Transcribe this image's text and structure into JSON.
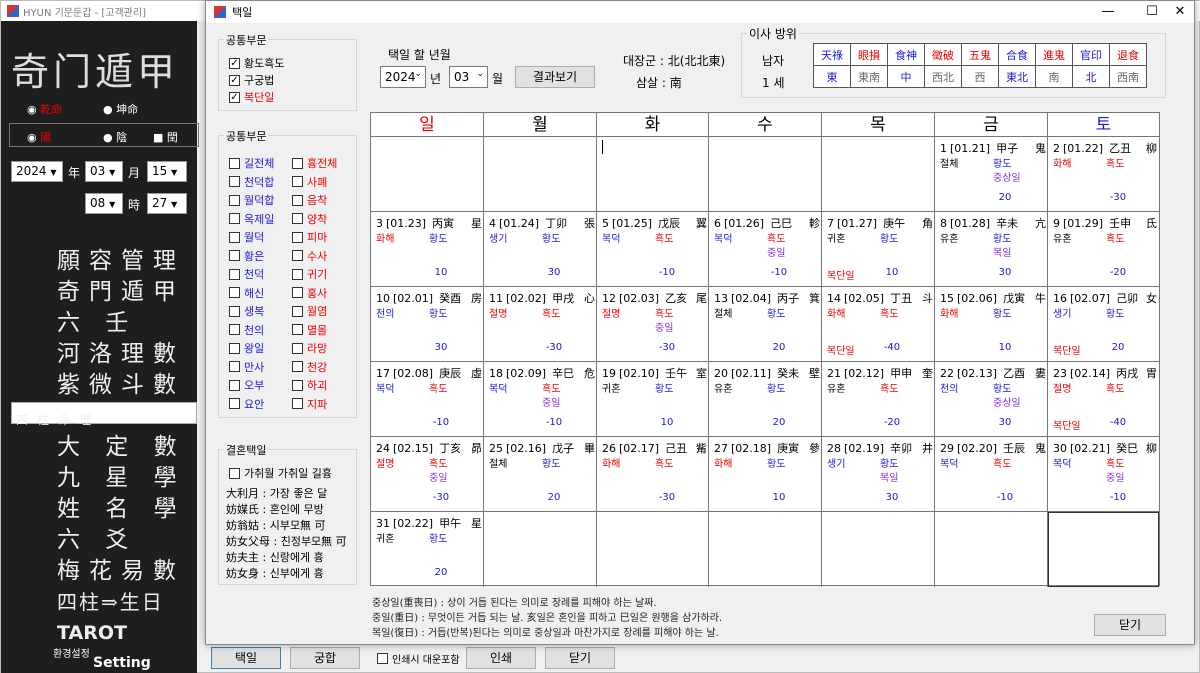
{
  "background_window": {
    "title": "HYUN 기문둔갑 - [고객관리]",
    "logo": "奇门遁甲",
    "gender": [
      "乾命",
      "坤命"
    ],
    "yinyang": [
      "陽",
      "陰"
    ],
    "leap": "閏",
    "year": "2024",
    "year_lbl": "年",
    "month": "03",
    "month_lbl": "月",
    "day": "15",
    "hour": "08",
    "hour_lbl": "時",
    "minute": "27",
    "menu": [
      "願容管理",
      "奇門遁甲",
      "六 壬",
      "河洛理數",
      "紫微斗數",
      "四柱命理",
      "大 定 數",
      "九 星 學",
      "姓 名 學",
      "六 爻",
      "梅花易數",
      "四柱⇒生日",
      "TAROT"
    ],
    "settings": "환경설정",
    "settings_en": "Setting",
    "buttons": [
      "택일",
      "궁합",
      "인쇄",
      "닫기"
    ],
    "print_check": "인쇄시 대운포함"
  },
  "dialog": {
    "title": "택일",
    "controls": {
      "minimize": "—",
      "maximize": "☐",
      "close": "✕"
    }
  },
  "group1": {
    "title": "공통부문",
    "items": [
      {
        "label": "황도흑도",
        "checked": true,
        "color": "#000"
      },
      {
        "label": "구궁법",
        "checked": true,
        "color": "#000"
      },
      {
        "label": "복단일",
        "checked": true,
        "color": "#e00"
      }
    ]
  },
  "group2": {
    "title": "공통부문",
    "left": [
      "길전체",
      "천덕합",
      "월덕합",
      "옥제일",
      "월덕",
      "황은",
      "천덕",
      "해신",
      "생복",
      "천의",
      "왕일",
      "만사",
      "오부",
      "요안"
    ],
    "right": [
      "흉전체",
      "사폐",
      "음착",
      "양착",
      "피마",
      "수사",
      "귀기",
      "홍사",
      "월염",
      "멸몰",
      "라망",
      "천강",
      "하괴",
      "지파"
    ]
  },
  "group3": {
    "title": "결혼택일",
    "check": "가취월 가취일 길흉",
    "rows": [
      "大利月 : 가장 좋은 달",
      "妨媒氏 : 혼인에 무방",
      "妨翁姑 : 시부모無 可",
      "妨女父母 : 친정부모無 可",
      "妨夫主 : 신랑에게 흉",
      "妨女身 : 신부에게 흉"
    ]
  },
  "selector": {
    "label": "택일 할 년월",
    "year": "2024",
    "year_unit": "년",
    "month": "03",
    "month_unit": "월",
    "button": "결과보기"
  },
  "daejang": {
    "l1": "대장군 : 北(北北東)",
    "l2": "삼살 : 南"
  },
  "move": {
    "title": "이사 방위",
    "gender": "남자",
    "age": "1 세",
    "headers": [
      {
        "t": "天祿",
        "c": "#1a1ad8"
      },
      {
        "t": "眼損",
        "c": "#e00"
      },
      {
        "t": "食神",
        "c": "#1a1ad8"
      },
      {
        "t": "徵破",
        "c": "#e00"
      },
      {
        "t": "五鬼",
        "c": "#e00"
      },
      {
        "t": "合食",
        "c": "#1a1ad8"
      },
      {
        "t": "進鬼",
        "c": "#e00"
      },
      {
        "t": "官印",
        "c": "#1a1ad8"
      },
      {
        "t": "退食",
        "c": "#e00"
      }
    ],
    "dirs": [
      {
        "t": "東",
        "c": "#1a1ad8"
      },
      {
        "t": "東南",
        "c": "#666"
      },
      {
        "t": "中",
        "c": "#1a1ad8"
      },
      {
        "t": "西北",
        "c": "#666"
      },
      {
        "t": "西",
        "c": "#666"
      },
      {
        "t": "東北",
        "c": "#1a1ad8"
      },
      {
        "t": "南",
        "c": "#666"
      },
      {
        "t": "北",
        "c": "#1a1ad8"
      },
      {
        "t": "西南",
        "c": "#666"
      }
    ]
  },
  "calendar": {
    "weekdays": [
      {
        "t": "일",
        "c": "#e00"
      },
      {
        "t": "월",
        "c": "#000"
      },
      {
        "t": "화",
        "c": "#000"
      },
      {
        "t": "수",
        "c": "#000"
      },
      {
        "t": "목",
        "c": "#000"
      },
      {
        "t": "금",
        "c": "#000"
      },
      {
        "t": "토",
        "c": "#1a1ad8"
      }
    ],
    "days": [
      {
        "d": "1",
        "lunar": "[01.21]",
        "gz": "甲子",
        "st": "鬼",
        "a": "절체",
        "ac": "#000",
        "b": "황도",
        "bc": "#1a1ad8",
        "c": "중상일",
        "cc": "#8a2be2",
        "bn": "",
        "sc": "20"
      },
      {
        "d": "2",
        "lunar": "[01.22]",
        "gz": "乙丑",
        "st": "柳",
        "a": "화해",
        "ac": "#e00",
        "b": "흑도",
        "bc": "#e00",
        "c": "",
        "cc": "#000",
        "bn": "",
        "sc": "-30"
      },
      {
        "d": "3",
        "lunar": "[01.23]",
        "gz": "丙寅",
        "st": "星",
        "a": "화해",
        "ac": "#e00",
        "b": "황도",
        "bc": "#1a1ad8",
        "c": "",
        "cc": "#000",
        "bn": "",
        "sc": "10"
      },
      {
        "d": "4",
        "lunar": "[01.24]",
        "gz": "丁卯",
        "st": "張",
        "a": "생기",
        "ac": "#1a1ad8",
        "b": "황도",
        "bc": "#1a1ad8",
        "c": "",
        "cc": "#000",
        "bn": "",
        "sc": "30"
      },
      {
        "d": "5",
        "lunar": "[01.25]",
        "gz": "戊辰",
        "st": "翼",
        "a": "복덕",
        "ac": "#1a1ad8",
        "b": "흑도",
        "bc": "#e00",
        "c": "",
        "cc": "#000",
        "bn": "",
        "sc": "-10"
      },
      {
        "d": "6",
        "lunar": "[01.26]",
        "gz": "己巳",
        "st": "軫",
        "a": "복덕",
        "ac": "#1a1ad8",
        "b": "흑도",
        "bc": "#e00",
        "c": "중일",
        "cc": "#8a2be2",
        "bn": "",
        "sc": "-10"
      },
      {
        "d": "7",
        "lunar": "[01.27]",
        "gz": "庚午",
        "st": "角",
        "a": "귀혼",
        "ac": "#000",
        "b": "황도",
        "bc": "#1a1ad8",
        "c": "",
        "cc": "#000",
        "bn": "복단일",
        "sc": "10"
      },
      {
        "d": "8",
        "lunar": "[01.28]",
        "gz": "辛未",
        "st": "亢",
        "a": "유혼",
        "ac": "#000",
        "b": "황도",
        "bc": "#1a1ad8",
        "c": "복일",
        "cc": "#8a2be2",
        "bn": "",
        "sc": "30"
      },
      {
        "d": "9",
        "lunar": "[01.29]",
        "gz": "壬申",
        "st": "氐",
        "a": "유혼",
        "ac": "#000",
        "b": "흑도",
        "bc": "#e00",
        "c": "",
        "cc": "#000",
        "bn": "",
        "sc": "-20"
      },
      {
        "d": "10",
        "lunar": "[02.01]",
        "gz": "癸酉",
        "st": "房",
        "a": "천의",
        "ac": "#1a1ad8",
        "b": "황도",
        "bc": "#1a1ad8",
        "c": "",
        "cc": "#000",
        "bn": "",
        "sc": "30"
      },
      {
        "d": "11",
        "lunar": "[02.02]",
        "gz": "甲戌",
        "st": "心",
        "a": "절명",
        "ac": "#e00",
        "b": "흑도",
        "bc": "#e00",
        "c": "",
        "cc": "#000",
        "bn": "",
        "sc": "-30"
      },
      {
        "d": "12",
        "lunar": "[02.03]",
        "gz": "乙亥",
        "st": "尾",
        "a": "절명",
        "ac": "#e00",
        "b": "흑도",
        "bc": "#e00",
        "c": "중일",
        "cc": "#8a2be2",
        "bn": "",
        "sc": "-30"
      },
      {
        "d": "13",
        "lunar": "[02.04]",
        "gz": "丙子",
        "st": "箕",
        "a": "절체",
        "ac": "#000",
        "b": "황도",
        "bc": "#1a1ad8",
        "c": "",
        "cc": "#000",
        "bn": "",
        "sc": "20"
      },
      {
        "d": "14",
        "lunar": "[02.05]",
        "gz": "丁丑",
        "st": "斗",
        "a": "화해",
        "ac": "#e00",
        "b": "흑도",
        "bc": "#e00",
        "c": "",
        "cc": "#000",
        "bn": "복단일",
        "sc": "-40"
      },
      {
        "d": "15",
        "lunar": "[02.06]",
        "gz": "戊寅",
        "st": "牛",
        "a": "화해",
        "ac": "#e00",
        "b": "황도",
        "bc": "#1a1ad8",
        "c": "",
        "cc": "#000",
        "bn": "",
        "sc": "10"
      },
      {
        "d": "16",
        "lunar": "[02.07]",
        "gz": "己卯",
        "st": "女",
        "a": "생기",
        "ac": "#1a1ad8",
        "b": "황도",
        "bc": "#1a1ad8",
        "c": "",
        "cc": "#000",
        "bn": "복단일",
        "sc": "20"
      },
      {
        "d": "17",
        "lunar": "[02.08]",
        "gz": "庚辰",
        "st": "虛",
        "a": "복덕",
        "ac": "#1a1ad8",
        "b": "흑도",
        "bc": "#e00",
        "c": "",
        "cc": "#000",
        "bn": "",
        "sc": "-10"
      },
      {
        "d": "18",
        "lunar": "[02.09]",
        "gz": "辛巳",
        "st": "危",
        "a": "복덕",
        "ac": "#1a1ad8",
        "b": "흑도",
        "bc": "#e00",
        "c": "중일",
        "cc": "#8a2be2",
        "bn": "",
        "sc": "-10"
      },
      {
        "d": "19",
        "lunar": "[02.10]",
        "gz": "壬午",
        "st": "室",
        "a": "귀혼",
        "ac": "#000",
        "b": "황도",
        "bc": "#1a1ad8",
        "c": "",
        "cc": "#000",
        "bn": "",
        "sc": "10"
      },
      {
        "d": "20",
        "lunar": "[02.11]",
        "gz": "癸未",
        "st": "壁",
        "a": "유혼",
        "ac": "#000",
        "b": "황도",
        "bc": "#1a1ad8",
        "c": "",
        "cc": "#000",
        "bn": "",
        "sc": "20"
      },
      {
        "d": "21",
        "lunar": "[02.12]",
        "gz": "甲申",
        "st": "奎",
        "a": "유혼",
        "ac": "#000",
        "b": "흑도",
        "bc": "#e00",
        "c": "",
        "cc": "#000",
        "bn": "",
        "sc": "-20"
      },
      {
        "d": "22",
        "lunar": "[02.13]",
        "gz": "乙酉",
        "st": "婁",
        "a": "천의",
        "ac": "#1a1ad8",
        "b": "황도",
        "bc": "#1a1ad8",
        "c": "중상일",
        "cc": "#8a2be2",
        "bn": "",
        "sc": "30"
      },
      {
        "d": "23",
        "lunar": "[02.14]",
        "gz": "丙戌",
        "st": "胃",
        "a": "절명",
        "ac": "#e00",
        "b": "흑도",
        "bc": "#e00",
        "c": "",
        "cc": "#000",
        "bn": "복단일",
        "sc": "-40"
      },
      {
        "d": "24",
        "lunar": "[02.15]",
        "gz": "丁亥",
        "st": "昴",
        "a": "절명",
        "ac": "#e00",
        "b": "흑도",
        "bc": "#e00",
        "c": "중일",
        "cc": "#8a2be2",
        "bn": "",
        "sc": "-30"
      },
      {
        "d": "25",
        "lunar": "[02.16]",
        "gz": "戊子",
        "st": "畢",
        "a": "절체",
        "ac": "#000",
        "b": "황도",
        "bc": "#1a1ad8",
        "c": "",
        "cc": "#000",
        "bn": "",
        "sc": "20"
      },
      {
        "d": "26",
        "lunar": "[02.17]",
        "gz": "己丑",
        "st": "觜",
        "a": "화해",
        "ac": "#e00",
        "b": "흑도",
        "bc": "#e00",
        "c": "",
        "cc": "#000",
        "bn": "",
        "sc": "-30"
      },
      {
        "d": "27",
        "lunar": "[02.18]",
        "gz": "庚寅",
        "st": "參",
        "a": "화해",
        "ac": "#e00",
        "b": "황도",
        "bc": "#1a1ad8",
        "c": "",
        "cc": "#000",
        "bn": "",
        "sc": "10"
      },
      {
        "d": "28",
        "lunar": "[02.19]",
        "gz": "辛卯",
        "st": "井",
        "a": "생기",
        "ac": "#1a1ad8",
        "b": "황도",
        "bc": "#1a1ad8",
        "c": "복일",
        "cc": "#8a2be2",
        "bn": "",
        "sc": "30"
      },
      {
        "d": "29",
        "lunar": "[02.20]",
        "gz": "壬辰",
        "st": "鬼",
        "a": "복덕",
        "ac": "#1a1ad8",
        "b": "흑도",
        "bc": "#e00",
        "c": "",
        "cc": "#000",
        "bn": "",
        "sc": "-10"
      },
      {
        "d": "30",
        "lunar": "[02.21]",
        "gz": "癸巳",
        "st": "柳",
        "a": "복덕",
        "ac": "#1a1ad8",
        "b": "흑도",
        "bc": "#e00",
        "c": "중일",
        "cc": "#8a2be2",
        "bn": "",
        "sc": "-10"
      },
      {
        "d": "31",
        "lunar": "[02.22]",
        "gz": "甲午",
        "st": "星",
        "a": "귀혼",
        "ac": "#000",
        "b": "황도",
        "bc": "#1a1ad8",
        "c": "",
        "cc": "#000",
        "bn": "",
        "sc": "20"
      }
    ]
  },
  "notes": [
    "중상일(重喪日) : 상이 거듭 된다는 의미로 장례를 피해야 하는 날짜.",
    "중일(重日) : 무엇이든 거듭 되는 날. 亥일은 혼인을 피하고 巳일은 원행을 삼가하라.",
    "복일(復日) : 거듭(반복)된다는 의미로 중상일과 마찬가지로 장례를 피해야 하는 날."
  ],
  "close_button": "닫기"
}
